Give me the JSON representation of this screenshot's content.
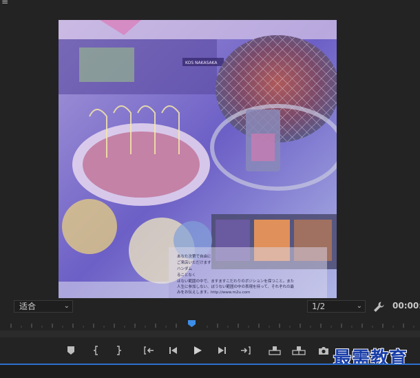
{
  "menu": {
    "glyph": "≡"
  },
  "monitor": {
    "fit_value": "适合",
    "resolution_value": "1/2",
    "timecode": "00:00:",
    "preview_caption_lines": [
      "あなた次第で自由に",
      "ご来店いただけます",
      "ハンダム",
      "ることなく",
      "ほない範囲の中で、ますますこだわりのポジションを保つこと。また",
      "人生に参加しない、ぼうない範囲の中の表現を持って、それぞれの最",
      "みをお伝えします。http://www.m2u.com"
    ],
    "preview_sign": "KOS NAKASAKA"
  },
  "transport": {
    "buttons": [
      "add-marker",
      "mark-in",
      "mark-out",
      "go-to-in",
      "step-back",
      "play",
      "step-forward",
      "go-to-out",
      "lift",
      "extract",
      "export-frame"
    ]
  },
  "watermark": {
    "text": "最需教育"
  },
  "colors": {
    "background": "#232323",
    "accent": "#2d6fd1",
    "watermark": "#1a3ea8"
  }
}
